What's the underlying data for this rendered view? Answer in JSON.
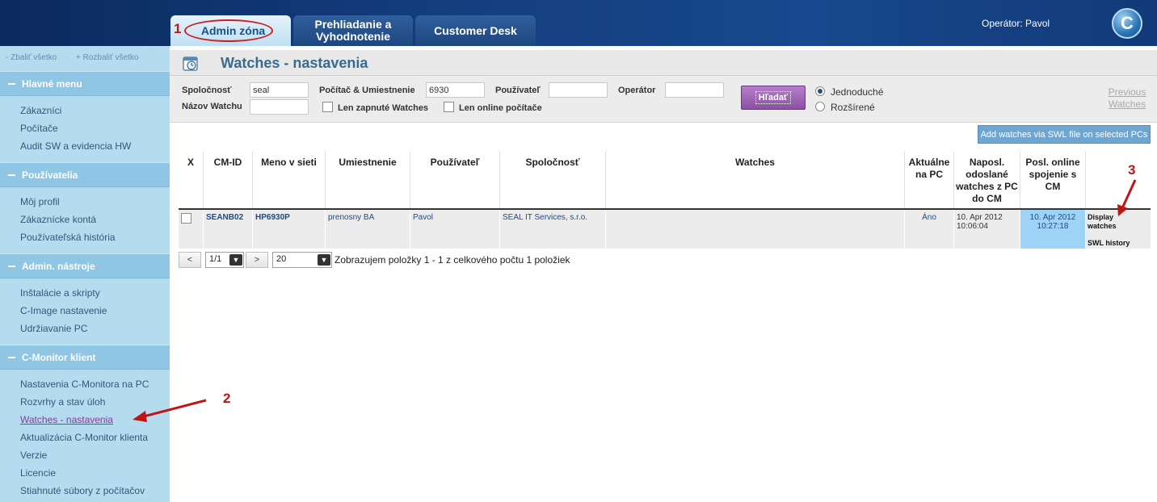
{
  "header": {
    "tabs": [
      {
        "label": "Admin zóna",
        "active": true
      },
      {
        "label": "Prehliadanie a Vyhodnotenie",
        "active": false
      },
      {
        "label": "Customer Desk",
        "active": false
      }
    ],
    "operator": "Operátor: Pavol",
    "logo_letter": "C"
  },
  "sidebar": {
    "collapse_all": "- Zbaliť všetko",
    "expand_all": "+ Rozbaliť všetko",
    "sections": [
      {
        "title": "Hlavné menu",
        "items": [
          "Zákazníci",
          "Počítače",
          "Audit SW a evidencia HW"
        ]
      },
      {
        "title": "Používatelia",
        "items": [
          "Môj profil",
          "Zákaznícke kontá",
          "Používateľská história"
        ]
      },
      {
        "title": "Admin. nástroje",
        "items": [
          "Inštalácie a skripty",
          "C-Image nastavenie",
          "Udržiavanie PC"
        ]
      },
      {
        "title": "C-Monitor klient",
        "items": [
          "Nastavenia C-Monitora na PC",
          "Rozvrhy a stav úloh",
          "Watches - nastavenia",
          "Aktualizácia C-Monitor klienta",
          "Verzie",
          "Licencie",
          "Stiahnuté súbory z počítačov"
        ]
      }
    ],
    "current_item": "Watches - nastavenia"
  },
  "page": {
    "title": "Watches - nastavenia"
  },
  "filter": {
    "company_label": "Spoločnosť",
    "company_value": "seal",
    "watch_name_label": "Názov Watchu",
    "watch_name_value": "",
    "pc_location_label": "Počítač & Umiestnenie",
    "pc_location_value": "6930",
    "user_label": "Používateľ",
    "user_value": "",
    "operator_label": "Operátor",
    "operator_value": "",
    "only_enabled_label": "Len zapnuté Watches",
    "only_online_label": "Len online počítače",
    "search_label": "Hľadať",
    "mode_simple": "Jednoduché",
    "mode_advanced": "Rozšírené",
    "previous_watches": "Previous Watches"
  },
  "swl_button": "Add watches via SWL file on selected PCs",
  "table": {
    "headers": [
      "X",
      "CM-ID",
      "Meno v sieti",
      "Umiestnenie",
      "Používateľ",
      "Spoločnosť",
      "Watches",
      "Aktuálne na PC",
      "Naposl. odoslané watches z PC do CM",
      "Posl. online spojenie s CM",
      ""
    ],
    "rows": [
      {
        "cm_id": "SEANB02",
        "hostname": "HP6930P",
        "location": "prenosny BA",
        "user": "Pavol",
        "company": "SEAL IT Services, s.r.o.",
        "watches": "",
        "current_on_pc": "Áno",
        "last_sent": "10. Apr 2012 10:06:04",
        "last_online": "10. Apr 2012 10:27:18",
        "action_display": "Display watches",
        "action_history": "SWL history"
      }
    ]
  },
  "pager": {
    "prev": "<",
    "page": "1/1",
    "next": ">",
    "page_size": "20",
    "info": "Zobrazujem položky 1 - 1 z celkového počtu 1 položiek"
  },
  "annotations": {
    "n1": "1",
    "n2": "2",
    "n3": "3"
  },
  "colors": {
    "accent_red": "#cc1f1f",
    "sidebar_bg": "#b5dbef",
    "section_bg": "#8fc6e4",
    "search_button": "#9b5fb5"
  }
}
